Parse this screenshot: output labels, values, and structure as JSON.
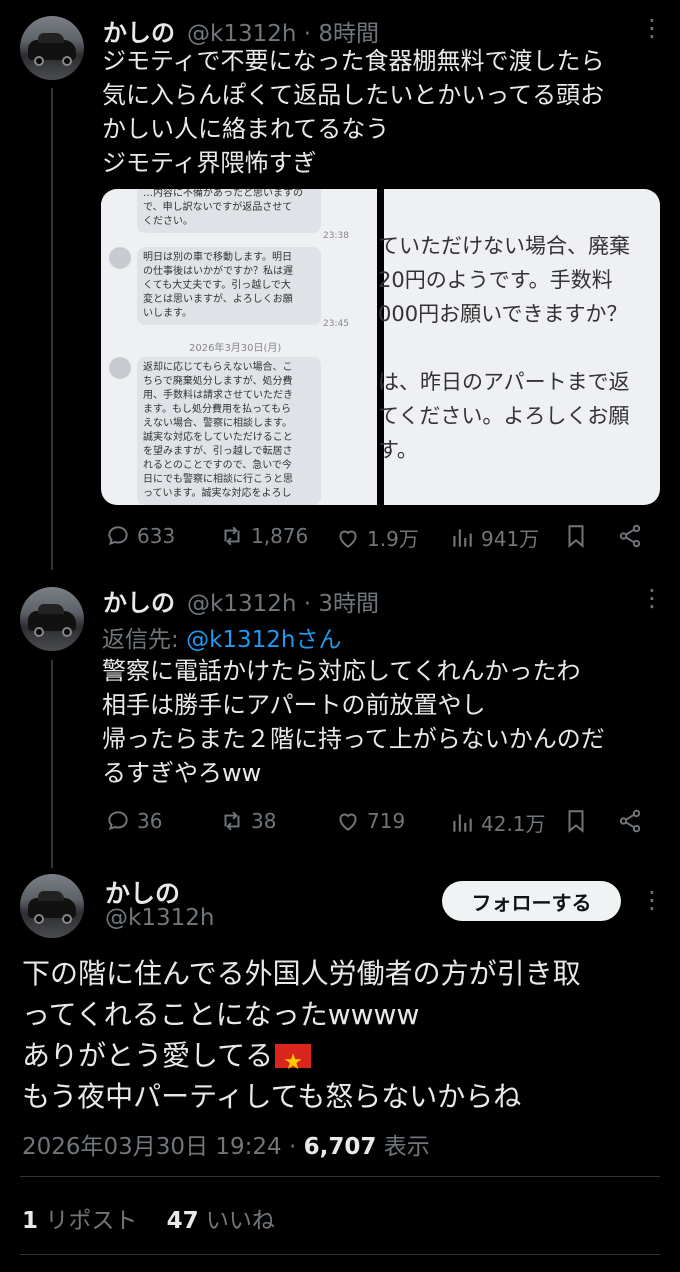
{
  "tweet1": {
    "name": "かしの",
    "handle": "@k1312h",
    "time": "8時間",
    "text": "ジモティで不要になった食器棚無料で渡したら\n気に入らんぽくて返品したいとかいってる頭お\nかしい人に絡まれてるなう\nジモティ界隈怖すぎ",
    "media_left": {
      "bubble1": "…内容に不備があったと思いますの\nで、申し訳ないですが返品させて\nください。",
      "time1": "23:38",
      "bubble2": "明日は別の車で移動します。明日\nの仕事後はいかがですか？私は遅\nくても大丈夫です。引っ越しで大\n変とは思いますが、よろしくお願\nいします。",
      "time2": "23:45",
      "date": "2026年3月30日(月)",
      "bubble3": "返却に応じてもらえない場合、こ\nちらで廃棄処分しますが、処分費\n用、手数料は請求させていただき\nます。もし処分費用を払ってもら\nえない場合、警察に相談します。\n誠実な対応をしていただけること\nを望みますが、引っ越しで転居さ\nれるとのことですので、急いで今\n日にでも警察に相談に行こうと思\nっています。誠実な対応をよろし"
    },
    "media_right": {
      "text": "ていただけない場合、廃棄\n20円のようです。手数料\n000円お願いできますか？\n\nは、昨日のアパートまで返\nてください。よろしくお願\nす。"
    },
    "replies": "633",
    "reposts": "1,876",
    "likes": "1.9万",
    "views": "941万"
  },
  "tweet2": {
    "name": "かしの",
    "handle": "@k1312h",
    "time": "3時間",
    "reply_label": "返信先:",
    "reply_handle": "@k1312hさん",
    "text": "警察に電話かけたら対応してくれんかったわ\n相手は勝手にアパートの前放置やし\n帰ったらまた２階に持って上がらないかんのだ\nるすぎやろww",
    "replies": "36",
    "reposts": "38",
    "likes": "719",
    "views": "42.1万"
  },
  "main_tweet": {
    "name": "かしの",
    "handle": "@k1312h",
    "follow_label": "フォローする",
    "text": "下の階に住んでる外国人労働者の方が引き取\nってくれることになったwwww\nありがとう愛してる",
    "text_after_flag": "\nもう夜中パーティしても怒らないからね",
    "flag_icon": "vietnam-flag",
    "timestamp": "2026年03月30日 19:24",
    "view_count": "6,707",
    "view_label": "表示",
    "repost_count": "1",
    "repost_label": "リポスト",
    "like_count": "47",
    "like_label": "いいね"
  },
  "colors": {
    "background": "#000000",
    "text": "#e7e9ea",
    "muted": "#71767b",
    "link": "#1d9bf0",
    "follow_bg": "#eff3f4"
  },
  "meta_separator": "·",
  "more_glyph": "⋮"
}
